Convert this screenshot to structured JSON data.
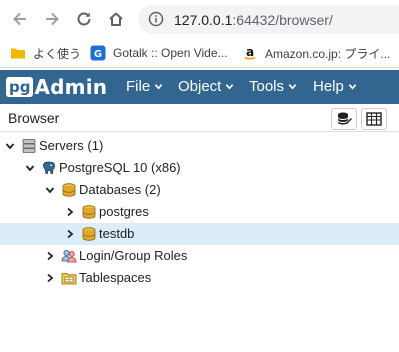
{
  "browser": {
    "url_host": "127.0.0.1",
    "url_rest": ":64432/browser/",
    "bookmarks": [
      {
        "label": "よく使う",
        "icon": "folder-icon"
      },
      {
        "label": "Gotalk :: Open Vide...",
        "icon": "gotalk-favicon"
      },
      {
        "label": "Amazon.co.jp: プライ...",
        "icon": "amazon-favicon"
      }
    ]
  },
  "app": {
    "brand_pg": "pg",
    "brand_admin": "Admin",
    "menu": [
      "File",
      "Object",
      "Tools",
      "Help"
    ]
  },
  "panel": {
    "title": "Browser",
    "buttons": [
      "query-tool-icon",
      "view-data-icon"
    ]
  },
  "tree": [
    {
      "label": "Servers (1)",
      "level": 0,
      "state": "expanded",
      "icon": "servers-icon"
    },
    {
      "label": "PostgreSQL 10 (x86)",
      "level": 1,
      "state": "expanded",
      "icon": "postgres-elephant-icon"
    },
    {
      "label": "Databases (2)",
      "level": 2,
      "state": "expanded",
      "icon": "databases-icon"
    },
    {
      "label": "postgres",
      "level": 3,
      "state": "collapsed",
      "icon": "database-icon"
    },
    {
      "label": "testdb",
      "level": 3,
      "state": "collapsed",
      "icon": "database-icon",
      "selected": true
    },
    {
      "label": "Login/Group Roles",
      "level": 2,
      "state": "collapsed",
      "icon": "roles-icon"
    },
    {
      "label": "Tablespaces",
      "level": 2,
      "state": "collapsed",
      "icon": "tablespaces-icon"
    }
  ],
  "colors": {
    "navbar": "#326690",
    "selected_row": "#dcecf9",
    "db_icon": "#e0a82e"
  }
}
